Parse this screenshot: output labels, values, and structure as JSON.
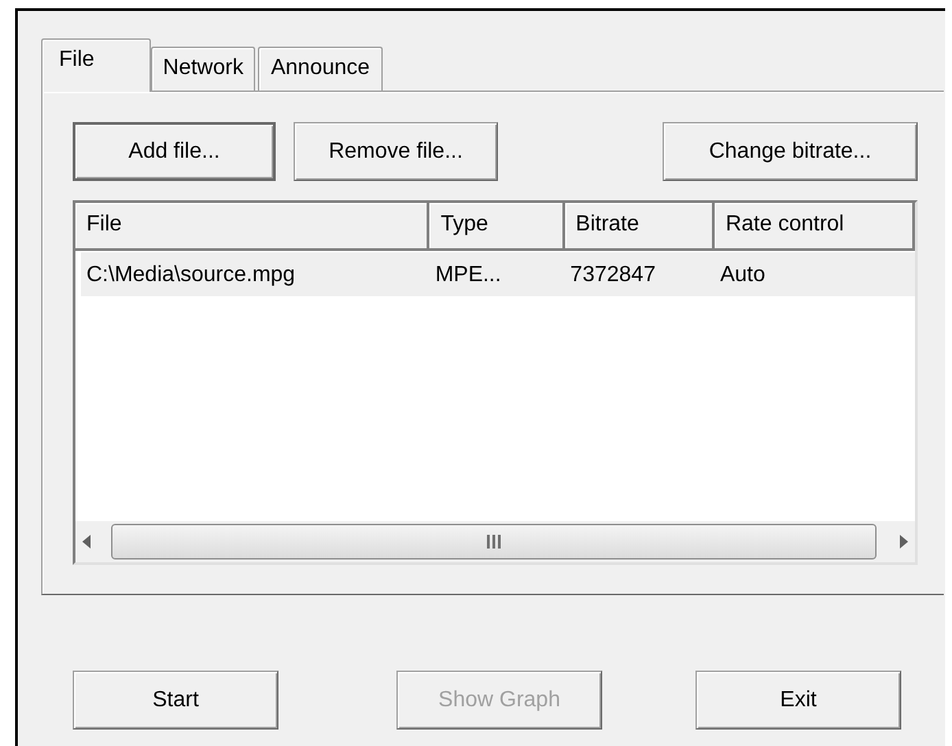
{
  "tabs": [
    {
      "label": "File",
      "selected": true
    },
    {
      "label": "Network",
      "selected": false
    },
    {
      "label": "Announce",
      "selected": false
    }
  ],
  "toolbar": [
    {
      "label": "Add file...",
      "default": true
    },
    {
      "label": "Remove file...",
      "default": false
    },
    {
      "label": "Change bitrate...",
      "default": false
    }
  ],
  "table": {
    "columns": [
      "File",
      "Type",
      "Bitrate",
      "Rate control"
    ],
    "rows": [
      {
        "cells": [
          "C:\\Media\\source.mpg",
          "MPE...",
          "7372847",
          "Auto"
        ],
        "selected": true
      }
    ]
  },
  "buttons": [
    {
      "label": "Start",
      "disabled": false
    },
    {
      "label": "Show Graph",
      "disabled": true
    },
    {
      "label": "Exit",
      "disabled": false
    }
  ]
}
